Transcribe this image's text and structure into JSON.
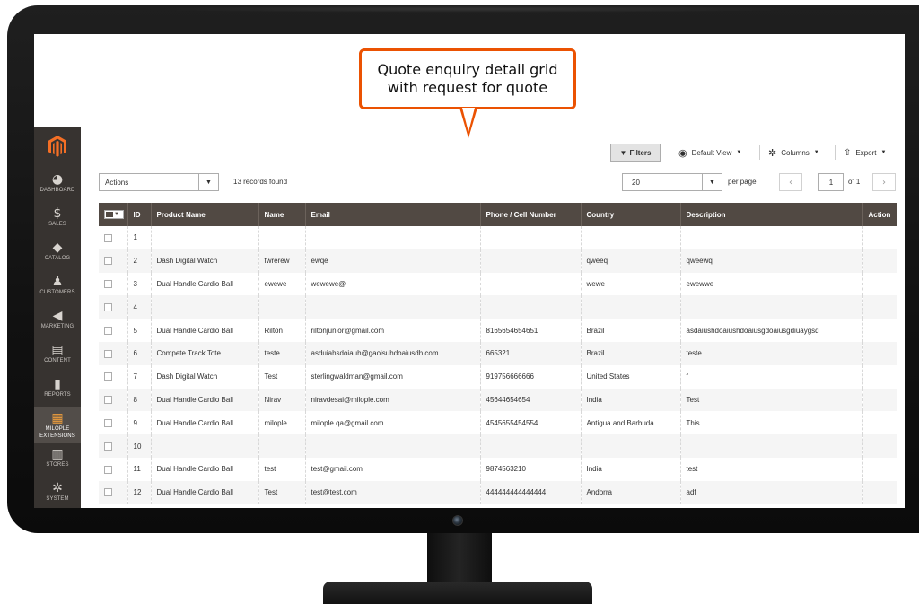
{
  "callout": {
    "line1": "Quote enquiry detail grid",
    "line2": "with request for quote"
  },
  "sidebar": {
    "items": [
      {
        "label": "DASHBOARD",
        "icon": "dashboard-icon",
        "glyph": "◕"
      },
      {
        "label": "SALES",
        "icon": "dollar-icon",
        "glyph": "$"
      },
      {
        "label": "CATALOG",
        "icon": "cube-icon",
        "glyph": "◆"
      },
      {
        "label": "CUSTOMERS",
        "icon": "person-icon",
        "glyph": "♟"
      },
      {
        "label": "MARKETING",
        "icon": "megaphone-icon",
        "glyph": "◀"
      },
      {
        "label": "CONTENT",
        "icon": "layout-icon",
        "glyph": "▤"
      },
      {
        "label": "REPORTS",
        "icon": "bar-chart-icon",
        "glyph": "▮"
      },
      {
        "label": "MILOPLE",
        "label2": "EXTENSIONS",
        "icon": "extensions-icon",
        "glyph": "▦"
      },
      {
        "label": "STORES",
        "icon": "store-icon",
        "glyph": "▥"
      },
      {
        "label": "SYSTEM",
        "icon": "gear-icon",
        "glyph": "✲"
      }
    ]
  },
  "toolbar": {
    "filters": "Filters",
    "default_view": "Default View",
    "columns": "Columns",
    "export": "Export"
  },
  "actions": {
    "label": "Actions",
    "records_found": "13 records found"
  },
  "pagination": {
    "per_page_value": "20",
    "per_page_label": "per page",
    "current_page": "1",
    "of_pages": "of 1"
  },
  "grid": {
    "columns": [
      "ID",
      "Product Name",
      "Name",
      "Email",
      "Phone / Cell Number",
      "Country",
      "Description",
      "Action"
    ],
    "rows": [
      [
        "1",
        "",
        "",
        "",
        "",
        "",
        "",
        ""
      ],
      [
        "2",
        "Dash Digital Watch",
        "fwrerew",
        "ewqe",
        "",
        "qweeq",
        "qweewq",
        ""
      ],
      [
        "3",
        "Dual Handle Cardio Ball",
        "ewewe",
        "wewewe@",
        "",
        "wewe",
        "ewewwe",
        ""
      ],
      [
        "4",
        "",
        "",
        "",
        "",
        "",
        "",
        ""
      ],
      [
        "5",
        "Dual Handle Cardio Ball",
        "Rilton",
        "riltonjunior@gmail.com",
        "8165654654651",
        "Brazil",
        "asdaiushdoaiushdoaiusgdoaiusgdiuaygsd",
        ""
      ],
      [
        "6",
        "Compete Track Tote",
        "teste",
        "asduiahsdoiauh@gaoisuhdoaiusdh.com",
        "665321",
        "Brazil",
        "teste",
        ""
      ],
      [
        "7",
        "Dash Digital Watch",
        "Test",
        "sterlingwaldman@gmail.com",
        "919756666666",
        "United States",
        "f",
        ""
      ],
      [
        "8",
        "Dual Handle Cardio Ball",
        "Nirav",
        "niravdesai@milople.com",
        "45644654654",
        "India",
        "Test",
        ""
      ],
      [
        "9",
        "Dual Handle Cardio Ball",
        "milople",
        "milople.qa@gmail.com",
        "4545655454554",
        "Antigua and Barbuda",
        "This",
        ""
      ],
      [
        "10",
        "",
        "",
        "",
        "",
        "",
        "",
        ""
      ],
      [
        "11",
        "Dual Handle Cardio Ball",
        "test",
        "test@gmail.com",
        "9874563210",
        "India",
        "test",
        ""
      ],
      [
        "12",
        "Dual Handle Cardio Ball",
        "Test",
        "test@test.com",
        "444444444444444",
        "Andorra",
        "adf",
        ""
      ]
    ]
  },
  "colors": {
    "accent": "#eb5202",
    "sidebar_bg": "#373330",
    "header_bg": "#514943"
  }
}
